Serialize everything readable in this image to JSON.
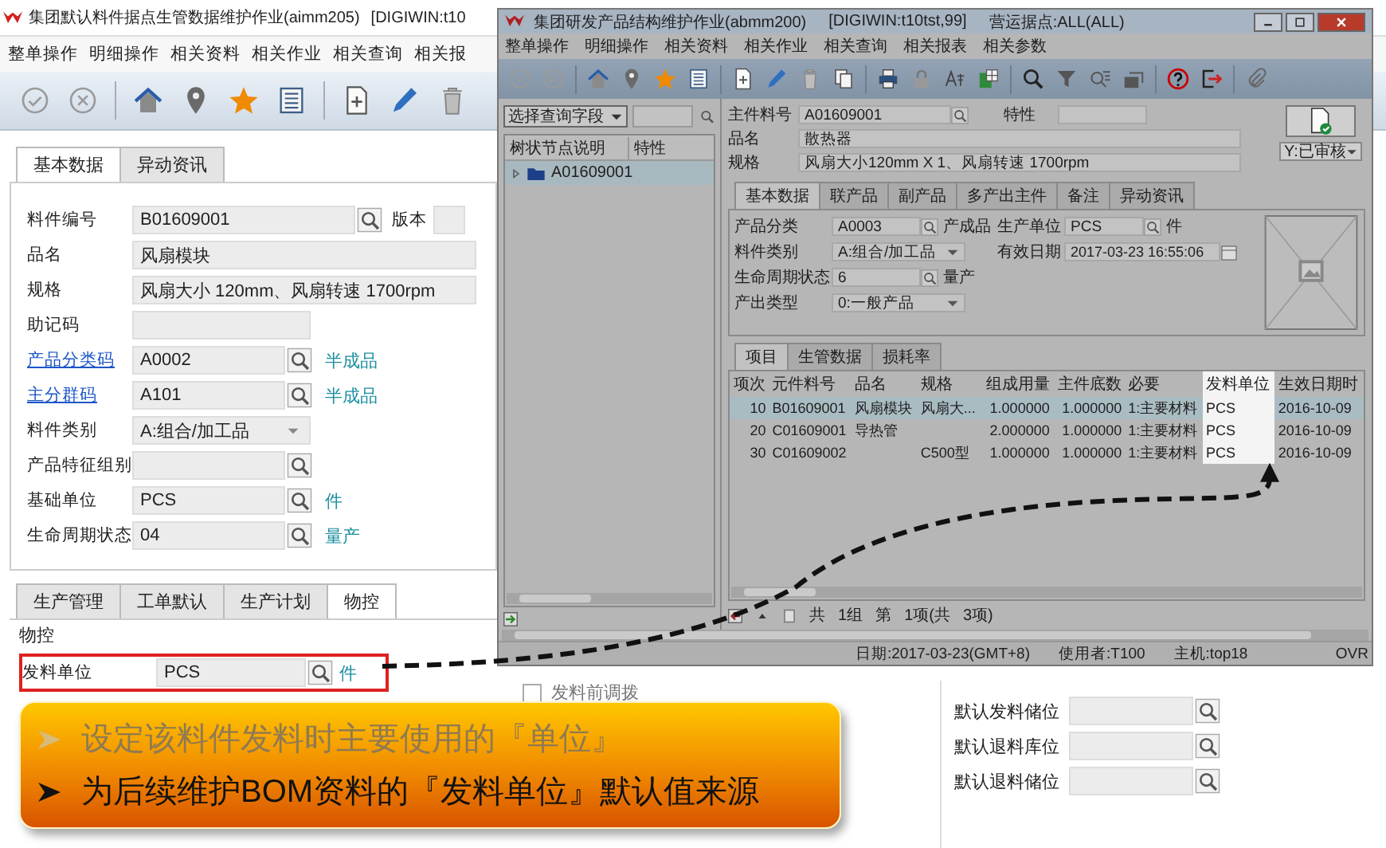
{
  "back_window": {
    "title": "集团默认料件据点生管数据维护作业(aimm205)",
    "title_extra": "[DIGIWIN:t10",
    "menu": [
      "整单操作",
      "明细操作",
      "相关资料",
      "相关作业",
      "相关查询",
      "相关报"
    ],
    "tabs": [
      {
        "label": "基本数据",
        "selected": true
      },
      {
        "label": "异动资讯",
        "selected": false
      }
    ],
    "fields": [
      {
        "kind": "search",
        "label": "料件编号",
        "link": false,
        "value": "B01609001",
        "side_label": "版本"
      },
      {
        "kind": "wide",
        "label": "品名",
        "link": false,
        "value": "风扇模块"
      },
      {
        "kind": "wide",
        "label": "规格",
        "link": false,
        "value": "风扇大小 120mm、风扇转速 1700rpm"
      },
      {
        "kind": "text",
        "label": "助记码",
        "link": false
      },
      {
        "kind": "search",
        "label": "产品分类码",
        "link": true,
        "value": "A0002",
        "hint": "半成品"
      },
      {
        "kind": "search",
        "label": "主分群码",
        "link": true,
        "value": "A101",
        "hint": "半成品"
      },
      {
        "kind": "select",
        "label": "料件类别",
        "link": false,
        "value": "A:组合/加工品"
      },
      {
        "kind": "search",
        "label": "产品特征组别",
        "link": false
      },
      {
        "kind": "search",
        "label": "基础单位",
        "link": false,
        "value": "PCS",
        "hint": "件"
      },
      {
        "kind": "search",
        "label": "生命周期状态",
        "link": false,
        "value": "04",
        "hint": "量产"
      }
    ],
    "lower_tabs": [
      {
        "label": "生产管理",
        "selected": false
      },
      {
        "label": "工单默认",
        "selected": false
      },
      {
        "label": "生产计划",
        "selected": false
      },
      {
        "label": "物控",
        "selected": true
      }
    ],
    "group": {
      "title": "物控",
      "field": {
        "label": "发料单位",
        "value": "PCS",
        "hint": "件",
        "highlighted": true
      }
    },
    "checkbox": {
      "label": "发料前调拨",
      "checked": false
    },
    "defaults": [
      {
        "label": "默认发料储位"
      },
      {
        "label": "默认退料库位"
      },
      {
        "label": "默认退料储位"
      }
    ]
  },
  "front_window": {
    "title": "集团研发产品结构维护作业(abmm200)",
    "env": "[DIGIWIN:t10tst,99]",
    "site": "营运据点:ALL(ALL)",
    "menu": [
      "整单操作",
      "明细操作",
      "相关资料",
      "相关作业",
      "相关查询",
      "相关报表",
      "相关参数"
    ],
    "query_select": "选择查询字段",
    "tree": {
      "columns": [
        "树状节点说明",
        "特性"
      ],
      "nodes": [
        {
          "label": "A01609001",
          "expanded": false,
          "selected": true
        }
      ]
    },
    "header": {
      "item_label": "主件料号",
      "item_value": "A01609001",
      "feature_label": "特性",
      "name_label": "品名",
      "name_value": "散热器",
      "spec_label": "规格",
      "spec_value": "风扇大小120mm X 1、风扇转速 1700rpm",
      "status": "Y:已审核"
    },
    "tabs": [
      {
        "label": "基本数据",
        "selected": true
      },
      {
        "label": "联产品",
        "selected": false
      },
      {
        "label": "副产品",
        "selected": false
      },
      {
        "label": "多产出主件",
        "selected": false
      },
      {
        "label": "备注",
        "selected": false
      },
      {
        "label": "异动资讯",
        "selected": false
      }
    ],
    "form_left": [
      {
        "kind": "search",
        "label": "产品分类",
        "value": "A0003",
        "hint": "产成品"
      },
      {
        "kind": "select",
        "label": "料件类别",
        "value": "A:组合/加工品"
      },
      {
        "kind": "search",
        "label": "生命周期状态",
        "value": "6",
        "hint": "量产"
      },
      {
        "kind": "select",
        "label": "产出类型",
        "value": "0:一般产品"
      }
    ],
    "form_right": [
      {
        "kind": "search",
        "label": "生产单位",
        "value": "PCS",
        "hint": "件"
      },
      {
        "kind": "date",
        "label": "有效日期",
        "value": "2017-03-23 16:55:06"
      }
    ],
    "detail_tabs": [
      {
        "label": "项目",
        "selected": true
      },
      {
        "label": "生管数据",
        "selected": false
      },
      {
        "label": "损耗率",
        "selected": false
      }
    ],
    "table": {
      "columns": [
        {
          "label": "项次",
          "highlighted": false
        },
        {
          "label": "元件料号",
          "highlighted": false
        },
        {
          "label": "品名",
          "highlighted": false
        },
        {
          "label": "规格",
          "highlighted": false
        },
        {
          "label": "组成用量",
          "highlighted": false
        },
        {
          "label": "主件底数",
          "highlighted": false
        },
        {
          "label": "必要",
          "highlighted": false
        },
        {
          "label": "发料单位",
          "highlighted": true
        },
        {
          "label": "生效日期时",
          "highlighted": false
        }
      ],
      "rows": [
        {
          "selected": true,
          "cells": [
            "10",
            "B01609001",
            "风扇模块",
            "风扇大...",
            "1.000000",
            "1.000000",
            "1:主要材料",
            "PCS",
            "2016-10-09"
          ]
        },
        {
          "selected": false,
          "cells": [
            "20",
            "C01609001",
            "导热管",
            null,
            "2.000000",
            "1.000000",
            "1:主要材料",
            "PCS",
            "2016-10-09"
          ]
        },
        {
          "selected": false,
          "cells": [
            "30",
            "C01609002",
            null,
            "C500型",
            "1.000000",
            "1.000000",
            "1:主要材料",
            "PCS",
            "2016-10-09"
          ]
        }
      ]
    },
    "pager": [
      "共",
      "1组",
      "第",
      "1项(共",
      "3项)"
    ],
    "status_bar": [
      "日期:2017-03-23(GMT+8)",
      "使用者:T100",
      "主机:top18",
      "OVR"
    ]
  },
  "callout": {
    "items": [
      {
        "text": "设定该料件发料时主要使用的『单位』",
        "dimmed": true
      },
      {
        "text": "为后续维护BOM资料的『发料单位』默认值来源",
        "dimmed": false
      }
    ]
  }
}
